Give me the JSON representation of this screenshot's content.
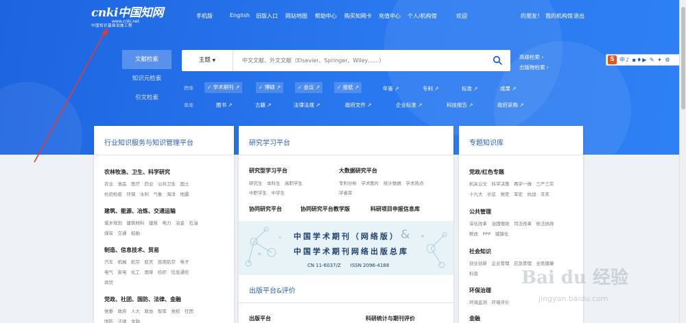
{
  "logo": {
    "main": "cnki中国知网",
    "url": "www.cnki.net",
    "sub": "中国知识基础设施工程"
  },
  "topnav": {
    "mobile": "手机版",
    "english": "English",
    "old": "旧版入口",
    "sitemap": "网站地图",
    "help": "帮助中心",
    "buycard": "购买知网卡",
    "recharge": "充值中心",
    "personal": "个人/机构馆",
    "welcome": "欢迎",
    "friend": "的朋友！",
    "myorg": "我的机构馆",
    "logout": "退出"
  },
  "tabs": [
    "文献检索",
    "知识元检索",
    "引文检索"
  ],
  "search": {
    "subject": "主题",
    "placeholder": "中文文献、外文文献（Elsevier、Springer、Wiley……）",
    "advanced": "高级检索",
    "publication": "出版物检索"
  },
  "rows": {
    "cross_label": "跨库",
    "cross_checked": [
      "学术期刊",
      "博硕",
      "会议",
      "报纸"
    ],
    "cross_links": [
      "年鉴",
      "专利",
      "标准",
      "成果"
    ],
    "single_label": "单库",
    "single_links": [
      "图书",
      "古籍",
      "法律法规",
      "政府文件",
      "企业标准",
      "科技报告",
      "政府采购"
    ]
  },
  "toolbar": {
    "s": "S",
    "rest": "中♪ ▪♦▶ ✎ ✦ ⚙"
  },
  "panel1": {
    "title": "行业知识服务与知识管理平台",
    "groups": [
      {
        "head": "农林牧渔、卫生、科学研究",
        "line1": "农业　食品　医疗　药业　公共卫生　国土",
        "line2": "检验检疫　环保　水利　气象　海洋　地震"
      },
      {
        "head": "建筑、能源、冶炼、交通运输",
        "line1": "城乡规划　建筑材料　建筑　电力　冶金　石油",
        "line2": "煤炭　交通　船舶"
      },
      {
        "head": "制造、信息技术、贸易",
        "line1": "汽车　机械　航空　航天　民用航空　电子",
        "line2": "电气　家电　化工　烟草　纺织　信息通信",
        "line3": "商贸"
      },
      {
        "head": "党政、社团、国防、法律、金融",
        "line1": "党委　政府　人大　政协　智库　党校　社团",
        "line2": "国防　法律　金融"
      }
    ]
  },
  "panel2": {
    "title": "研究学习平台",
    "col1_head": "研究型学习平台",
    "col1_line1": "研究生　本科生　高职学生",
    "col1_line2": "中职学生　中学生",
    "col2_head": "大数据研究平台",
    "col2_line1": "专利分析　学术图片　统计数据　学术热点",
    "col2_line2": "学者库",
    "row2": [
      "协同研究平台",
      "协同研究平台教学版",
      "科研项目申报信息库"
    ],
    "banner_line1": "中国学术期刊（网络版）",
    "banner_amp": "&",
    "banner_line2": "中国学术期刊网络出版总库",
    "banner_line3": "CN 11-6037/Z　　ISSN 2096-4188",
    "title2": "出版平台&评价",
    "bottom": [
      "出版平台",
      "科研统计与期刊评价"
    ]
  },
  "panel3": {
    "title": "专题知识库",
    "groups": [
      {
        "head": "党政/红色专题",
        "line1": "机关公文　科学决策　两学一做　三严三实",
        "line2": "十九大　长征　党史　军史　抗战　辛亥"
      },
      {
        "head": "公共管理",
        "line1": "深化改革　治国理政　司法改革　依法执政",
        "line2": "税改　PPP　城镇化"
      },
      {
        "head": "社会知识",
        "line1": "创业创新　企业管理　应急管理　全民健康",
        "line2": "科普"
      },
      {
        "head": "环保治理",
        "line1": "环境监测　环境评价"
      },
      {
        "head": "金融"
      }
    ]
  },
  "watermark": {
    "main": "Bai du 经验",
    "sub": "jingyan.baidu.com"
  }
}
